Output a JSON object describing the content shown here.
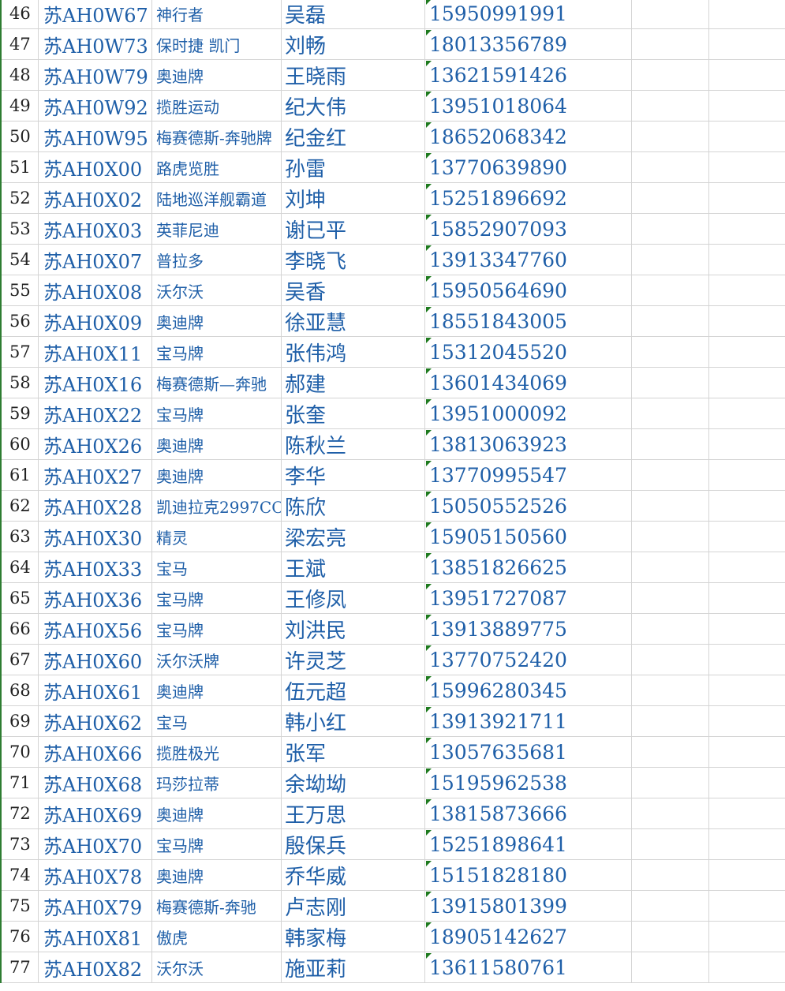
{
  "sheet": {
    "rows": [
      {
        "num": "46",
        "plate": "苏AH0W67",
        "brand": "神行者",
        "name": "吴磊",
        "phone": "15950991991"
      },
      {
        "num": "47",
        "plate": "苏AH0W73",
        "brand": "保时捷 凯门",
        "name": "刘畅",
        "phone": "18013356789"
      },
      {
        "num": "48",
        "plate": "苏AH0W79",
        "brand": "奥迪牌",
        "name": "王晓雨",
        "phone": "13621591426"
      },
      {
        "num": "49",
        "plate": "苏AH0W92",
        "brand": "揽胜运动",
        "name": "纪大伟",
        "phone": "13951018064"
      },
      {
        "num": "50",
        "plate": "苏AH0W95",
        "brand": "梅赛德斯-奔驰牌",
        "name": "纪金红",
        "phone": "18652068342"
      },
      {
        "num": "51",
        "plate": "苏AH0X00",
        "brand": "路虎览胜",
        "name": "孙雷",
        "phone": "13770639890"
      },
      {
        "num": "52",
        "plate": "苏AH0X02",
        "brand": "陆地巡洋舰霸道",
        "name": "刘坤",
        "phone": "15251896692"
      },
      {
        "num": "53",
        "plate": "苏AH0X03",
        "brand": "英菲尼迪",
        "name": "谢已平",
        "phone": "15852907093"
      },
      {
        "num": "54",
        "plate": "苏AH0X07",
        "brand": "普拉多",
        "name": "李晓飞",
        "phone": "13913347760"
      },
      {
        "num": "55",
        "plate": "苏AH0X08",
        "brand": "沃尔沃",
        "name": "吴香",
        "phone": "15950564690"
      },
      {
        "num": "56",
        "plate": "苏AH0X09",
        "brand": "奥迪牌",
        "name": "徐亚慧",
        "phone": "18551843005"
      },
      {
        "num": "57",
        "plate": "苏AH0X11",
        "brand": "宝马牌",
        "name": "张伟鸿",
        "phone": "15312045520"
      },
      {
        "num": "58",
        "plate": "苏AH0X16",
        "brand": "梅赛德斯—奔驰",
        "name": "郝建",
        "phone": "13601434069"
      },
      {
        "num": "59",
        "plate": "苏AH0X22",
        "brand": "宝马牌",
        "name": "张奎",
        "phone": "13951000092"
      },
      {
        "num": "60",
        "plate": "苏AH0X26",
        "brand": "奥迪牌",
        "name": "陈秋兰",
        "phone": "13813063923"
      },
      {
        "num": "61",
        "plate": "苏AH0X27",
        "brand": "奥迪牌",
        "name": "李华",
        "phone": "13770995547"
      },
      {
        "num": "62",
        "plate": "苏AH0X28",
        "brand": "凯迪拉克2997CC",
        "name": "陈欣",
        "phone": "15050552526"
      },
      {
        "num": "63",
        "plate": "苏AH0X30",
        "brand": "精灵",
        "name": "梁宏亮",
        "phone": "15905150560"
      },
      {
        "num": "64",
        "plate": "苏AH0X33",
        "brand": "宝马",
        "name": "王斌",
        "phone": "13851826625"
      },
      {
        "num": "65",
        "plate": "苏AH0X36",
        "brand": "宝马牌",
        "name": "王修凤",
        "phone": "13951727087"
      },
      {
        "num": "66",
        "plate": "苏AH0X56",
        "brand": "宝马牌",
        "name": "刘洪民",
        "phone": "13913889775"
      },
      {
        "num": "67",
        "plate": "苏AH0X60",
        "brand": "沃尔沃牌",
        "name": "许灵芝",
        "phone": "13770752420"
      },
      {
        "num": "68",
        "plate": "苏AH0X61",
        "brand": "奥迪牌",
        "name": "伍元超",
        "phone": "15996280345"
      },
      {
        "num": "69",
        "plate": "苏AH0X62",
        "brand": "宝马",
        "name": "韩小红",
        "phone": "13913921711"
      },
      {
        "num": "70",
        "plate": "苏AH0X66",
        "brand": "揽胜极光",
        "name": "张军",
        "phone": "13057635681"
      },
      {
        "num": "71",
        "plate": "苏AH0X68",
        "brand": "玛莎拉蒂",
        "name": "余坳坳",
        "phone": "15195962538"
      },
      {
        "num": "72",
        "plate": "苏AH0X69",
        "brand": "奥迪牌",
        "name": "王万思",
        "phone": "13815873666"
      },
      {
        "num": "73",
        "plate": "苏AH0X70",
        "brand": "宝马牌",
        "name": "殷保兵",
        "phone": "15251898641"
      },
      {
        "num": "74",
        "plate": "苏AH0X78",
        "brand": "奥迪牌",
        "name": "乔华威",
        "phone": "15151828180"
      },
      {
        "num": "75",
        "plate": "苏AH0X79",
        "brand": "梅赛德斯-奔驰",
        "name": "卢志刚",
        "phone": "13915801399"
      },
      {
        "num": "76",
        "plate": "苏AH0X81",
        "brand": "傲虎",
        "name": "韩家梅",
        "phone": "18905142627"
      },
      {
        "num": "77",
        "plate": "苏AH0X82",
        "brand": "沃尔沃",
        "name": "施亚莉",
        "phone": "13611580761"
      }
    ]
  },
  "colors": {
    "cell_text": "#1f5fa8",
    "row_header_text": "#222222",
    "gridline": "#d4d4d4",
    "number_as_text_indicator": "#1e7a1e"
  }
}
